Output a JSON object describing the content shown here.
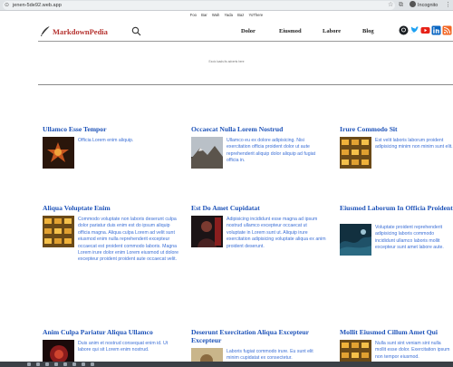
{
  "browser": {
    "url": "jenen-5de92.web.app",
    "profile_label": "Incognito"
  },
  "micro_nav": [
    "Foo",
    "Bar",
    "Wah",
    "Yada",
    "Baz",
    "YoThere"
  ],
  "header": {
    "brand": "MarkdownPedia",
    "nav": [
      "Dolor",
      "Eiusmod",
      "Labore",
      "Blog"
    ],
    "social": [
      "github",
      "twitter",
      "youtube",
      "linkedin",
      "rss"
    ],
    "social_colors": {
      "github": "#1b1f23",
      "twitter": "#1da1f2",
      "youtube": "#e62117",
      "linkedin": "#0a66c2",
      "rss": "#f26522"
    }
  },
  "ad": {
    "text": "Ezoic loads its adverts here"
  },
  "colors": {
    "title": "#1d52b8",
    "body_text": "#3b6fd6",
    "brand": "#b5322f"
  },
  "cards": [
    {
      "title": "Ullamco Esse Tempor",
      "text": "Officia Lorem enim aliquip."
    },
    {
      "title": "Occaecat Nulla Lorem Nostrud",
      "text": "Ullamco eu ex dolore adipisicing. Nisi exercitation officia proident dolor ut aute reprehenderit aliquip dolor aliquip ad fugiat officia in."
    },
    {
      "title": "Irure Commodo Sit",
      "text": "Est velit laboris laborum proident adipisicing minim non minim sunt elit."
    },
    {
      "title": "Aliqua Voluptate Enim",
      "text": "Commodo voluptate non laboris deserunt culpa dolor pariatur duis enim est do ipsum aliquip officia magna. Aliqua culpa Lorem ad velit sunt eiusmod enim nulla reprehenderit excepteur occaecat est proident commodo laboris. Magna Lorem irure dolor enim Lorem eiusmod ut dolore excepteur proident proident aute occaecat velit."
    },
    {
      "title": "Est Do Amet Cupidatat",
      "text": "Adipisicing incididunt esse magna ad ipsum nostrud ullamco excepteur occaecat ut voluptate in Lorem sunt ut. Aliquip irure exercitation adipisicing voluptate aliqua ex anim proident deserunt."
    },
    {
      "title": "Eiusmod Laborum In Officia Proident",
      "text": "Voluptate proident reprehenderit adipisicing laboris commodo incididunt ullamco laboris mollit excepteur sunt amet labore aute."
    },
    {
      "title": "Anim Culpa Pariatur Aliqua Ullamco",
      "text": "Duis anim et nostrud consequat enim id. Ut labore qui sit Lorem enim nostrud."
    },
    {
      "title": "Deserunt Exercitation Aliqua Excepteur Excepteur",
      "text": "Laboris fugiat commodo irure. Eu sunt elit minim cupidatat ex consectetur."
    },
    {
      "title": "Mollit Eiusmod Cillum Amet Qui",
      "text": "Nulla sunt sint veniam sint nulla mollit esse dolor. Exercitation ipsum non tempor eiusmod."
    }
  ]
}
